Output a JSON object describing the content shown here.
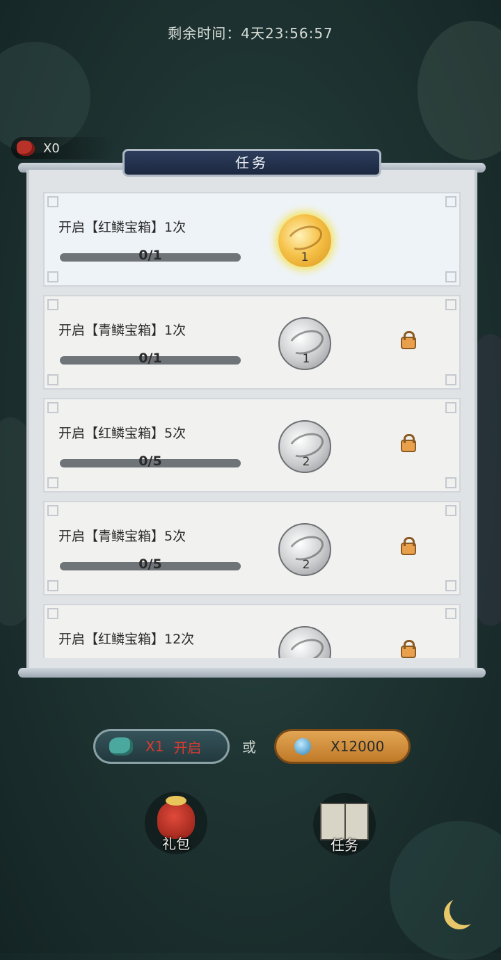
{
  "timer": {
    "label": "剩余时间：",
    "value": "4天23:56:57"
  },
  "currency": {
    "count": "X0",
    "icon": "red-scale-icon"
  },
  "panel": {
    "title": "任务"
  },
  "tasks": [
    {
      "title": "开启【红鳞宝箱】1次",
      "progress": "0/1",
      "reward_count": "1",
      "state": "active",
      "locked": false
    },
    {
      "title": "开启【青鳞宝箱】1次",
      "progress": "0/1",
      "reward_count": "1",
      "state": "locked",
      "locked": true
    },
    {
      "title": "开启【红鳞宝箱】5次",
      "progress": "0/5",
      "reward_count": "2",
      "state": "locked",
      "locked": true
    },
    {
      "title": "开启【青鳞宝箱】5次",
      "progress": "0/5",
      "reward_count": "2",
      "state": "locked",
      "locked": true
    },
    {
      "title": "开启【红鳞宝箱】12次",
      "progress": "",
      "reward_count": "",
      "state": "locked",
      "locked": true
    }
  ],
  "actions": {
    "open": {
      "multiplier": "X1",
      "label": "开启",
      "icon": "teal-scale-icon"
    },
    "or": "或",
    "buy": {
      "price": "X12000",
      "icon": "blue-gem-icon"
    }
  },
  "bottom": {
    "gift_label": "礼包",
    "task_label": "任务"
  },
  "colors": {
    "accent_red": "#d83b32",
    "panel_title_bg": "#2d3d5c",
    "gold_orb": "#f6c24a",
    "gem_button": "#e2a554"
  }
}
